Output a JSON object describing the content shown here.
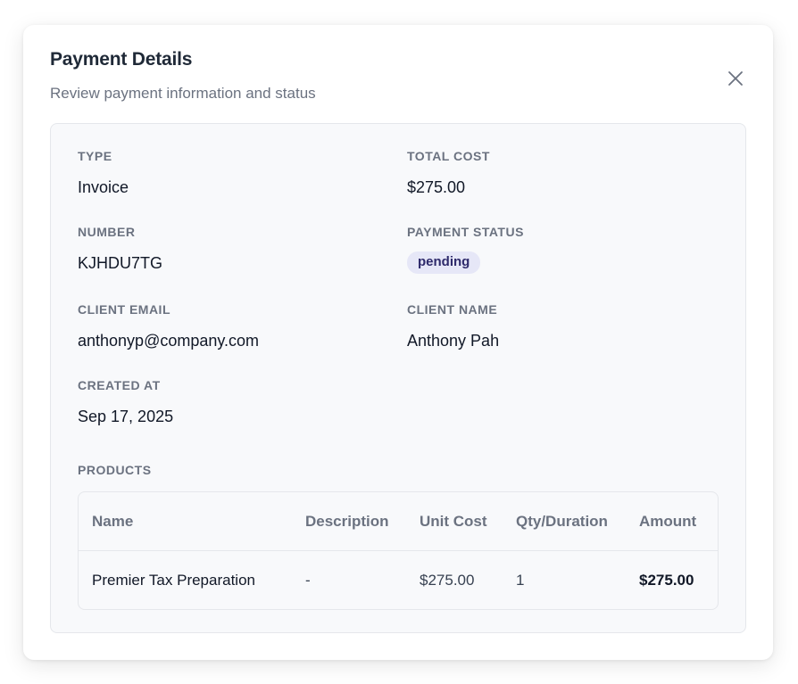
{
  "modal": {
    "title": "Payment Details",
    "subtitle": "Review payment information and status",
    "close_icon": "close-icon"
  },
  "details": {
    "type": {
      "label": "TYPE",
      "value": "Invoice"
    },
    "total_cost": {
      "label": "TOTAL COST",
      "value": "$275.00"
    },
    "number": {
      "label": "NUMBER",
      "value": "KJHDU7TG"
    },
    "payment_status": {
      "label": "PAYMENT STATUS",
      "value": "pending"
    },
    "client_email": {
      "label": "CLIENT EMAIL",
      "value": "anthonyp@company.com"
    },
    "client_name": {
      "label": "CLIENT NAME",
      "value": "Anthony Pah"
    },
    "created_at": {
      "label": "CREATED AT",
      "value": "Sep 17, 2025"
    }
  },
  "products": {
    "label": "PRODUCTS",
    "columns": [
      "Name",
      "Description",
      "Unit Cost",
      "Qty/Duration",
      "Amount"
    ],
    "rows": [
      [
        "Premier Tax Preparation",
        "-",
        "$275.00",
        "1",
        "$275.00"
      ]
    ]
  },
  "colors": {
    "badge_bg": "#e6e7f7",
    "badge_text": "#2e2a6b",
    "panel_bg": "#f8f9fb",
    "border": "#e5e7eb",
    "label": "#6b7280"
  }
}
